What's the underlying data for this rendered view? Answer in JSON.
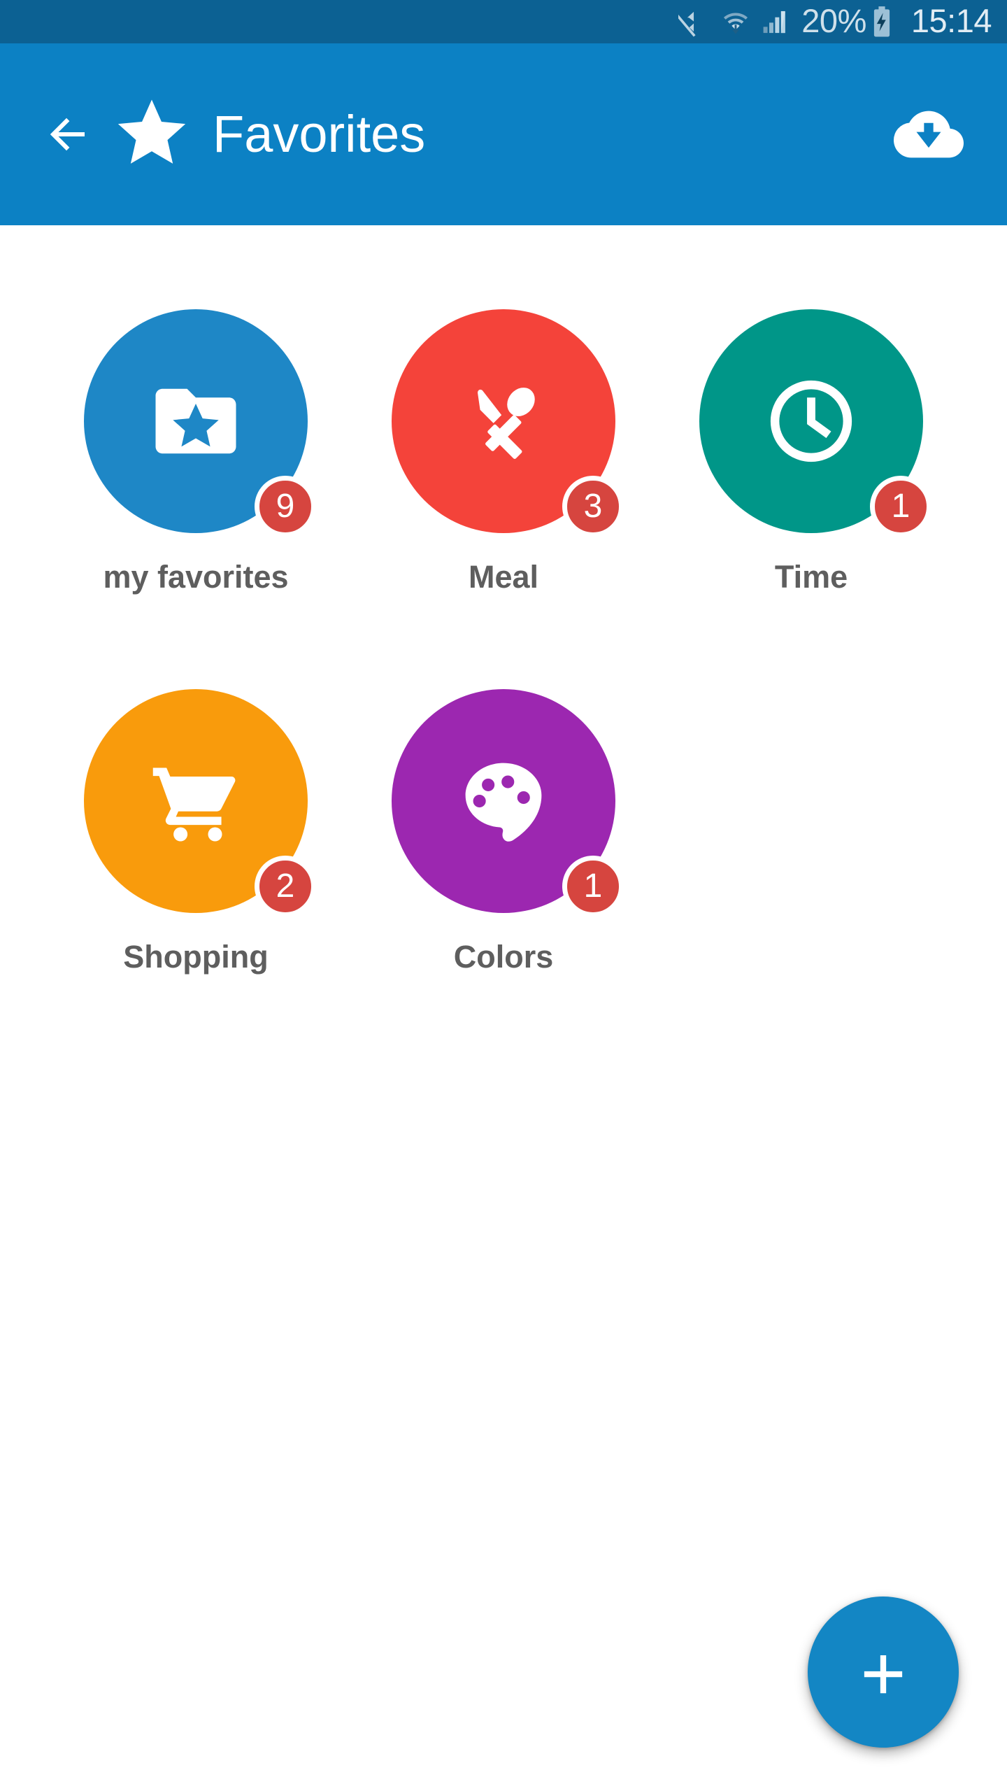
{
  "status_bar": {
    "icons": [
      "mute-icon",
      "wifi-download-icon",
      "cellular-signal-icon",
      "battery-charging-icon"
    ],
    "battery_percent": "20%",
    "time": "15:14",
    "background_color": "#0C6193",
    "text_color": "#CFE0EA"
  },
  "app_bar": {
    "back_label": "back-arrow",
    "brand_icon": "star-icon",
    "title": "Favorites",
    "action_icon": "cloud-download-icon",
    "background_color": "#0C81C4",
    "title_color": "#FFFFFF"
  },
  "grid": {
    "items": [
      {
        "label": "my favorites",
        "badge": "9",
        "color": "#1E87C6",
        "icon": "folder-star-icon"
      },
      {
        "label": "Meal",
        "badge": "3",
        "color": "#F4433A",
        "icon": "knife-spoon-icon"
      },
      {
        "label": "Time",
        "badge": "1",
        "color": "#009688",
        "icon": "clock-icon"
      },
      {
        "label": "Shopping",
        "badge": "2",
        "color": "#F99B0C",
        "icon": "shopping-cart-icon"
      },
      {
        "label": "Colors",
        "badge": "1",
        "color": "#9C27B0",
        "icon": "palette-icon"
      }
    ],
    "badge_color": "#D6453F",
    "label_color": "#5E5E5E"
  },
  "fab": {
    "icon": "plus-icon",
    "color": "#1386C4"
  }
}
